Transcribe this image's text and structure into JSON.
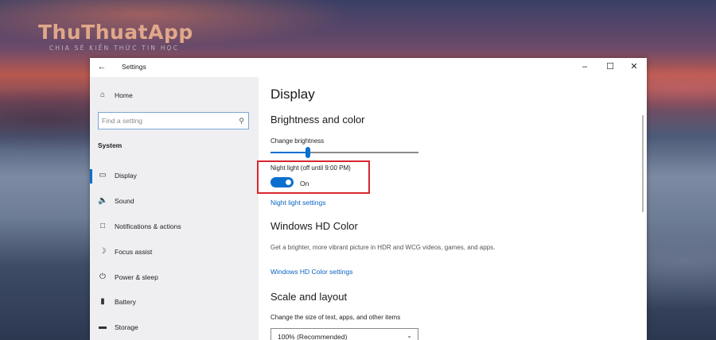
{
  "watermark": {
    "brand": "ThuThuatApp",
    "tagline": "CHIA SẺ KIẾN THỨC TIN HỌC"
  },
  "window": {
    "title": "Settings",
    "controls": {
      "minimize": "–",
      "maximize": "☐",
      "close": "✕"
    }
  },
  "sidebar": {
    "home_label": "Home",
    "search_placeholder": "Find a setting",
    "group_label": "System",
    "items": [
      {
        "label": "Display",
        "icon": "monitor-icon",
        "active": true
      },
      {
        "label": "Sound",
        "icon": "speaker-icon"
      },
      {
        "label": "Notifications & actions",
        "icon": "notification-icon"
      },
      {
        "label": "Focus assist",
        "icon": "moon-icon"
      },
      {
        "label": "Power & sleep",
        "icon": "power-icon"
      },
      {
        "label": "Battery",
        "icon": "battery-icon"
      },
      {
        "label": "Storage",
        "icon": "storage-icon"
      }
    ]
  },
  "content": {
    "page_title": "Display",
    "brightness": {
      "section_title": "Brightness and color",
      "slider_label": "Change brightness",
      "slider_value": 0.25
    },
    "night_light": {
      "label": "Night light (off until 9:00 PM)",
      "toggle_state": "On",
      "settings_link": "Night light settings"
    },
    "hd_color": {
      "section_title": "Windows HD Color",
      "description": "Get a brighter, more vibrant picture in HDR and WCG videos, games, and apps.",
      "settings_link": "Windows HD Color settings"
    },
    "scale": {
      "section_title": "Scale and layout",
      "label": "Change the size of text, apps, and other items",
      "value": "100% (Recommended)"
    }
  },
  "colors": {
    "accent": "#0b6fd0",
    "highlight": "#d8262d",
    "link": "#0a64c2"
  }
}
